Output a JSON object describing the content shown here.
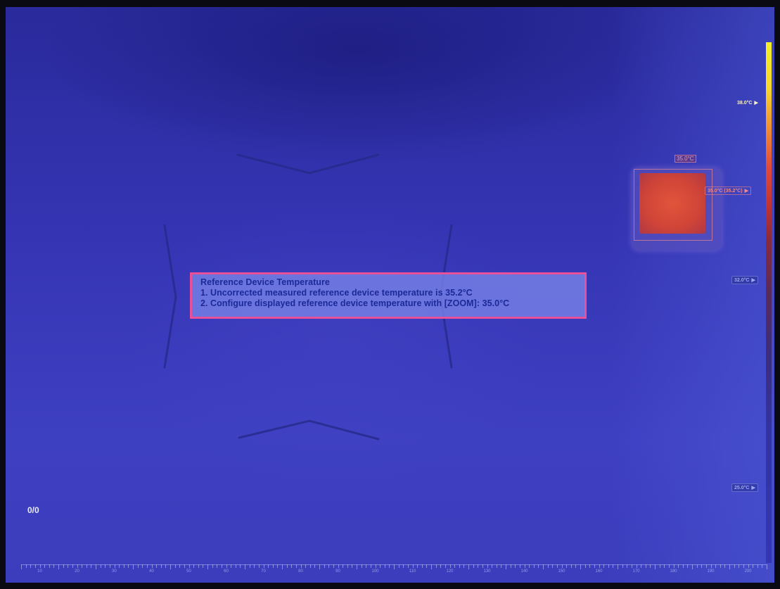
{
  "popup": {
    "title": "Reference Device Temperature",
    "line1": "1. Uncorrected measured reference device temperature is 35.2°C",
    "line2": "2. Configure displayed reference device temperature with [ZOOM]: 35.0°C"
  },
  "counter": "0/0",
  "reference_device": {
    "label": "35.0°C"
  },
  "colorbar": {
    "markers": {
      "top": "38.0°C",
      "current": "35.0°C (35.2°C)",
      "mid": "32.0°C",
      "low": "25.0°C"
    }
  },
  "ruler_labels": [
    "10",
    "20",
    "30",
    "40",
    "50",
    "60",
    "70",
    "80",
    "90",
    "100",
    "110",
    "120",
    "130",
    "140",
    "150",
    "160",
    "170",
    "180",
    "190",
    "200"
  ],
  "colors": {
    "background": "#3a3cbc",
    "popup_border": "#e8509a",
    "popup_text": "#1b2a98",
    "hot_spot": "#d64a3a"
  },
  "icons": {
    "target_brackets": "crosshair-bracket-icon",
    "marker_arrow": "triangle-right-icon"
  }
}
